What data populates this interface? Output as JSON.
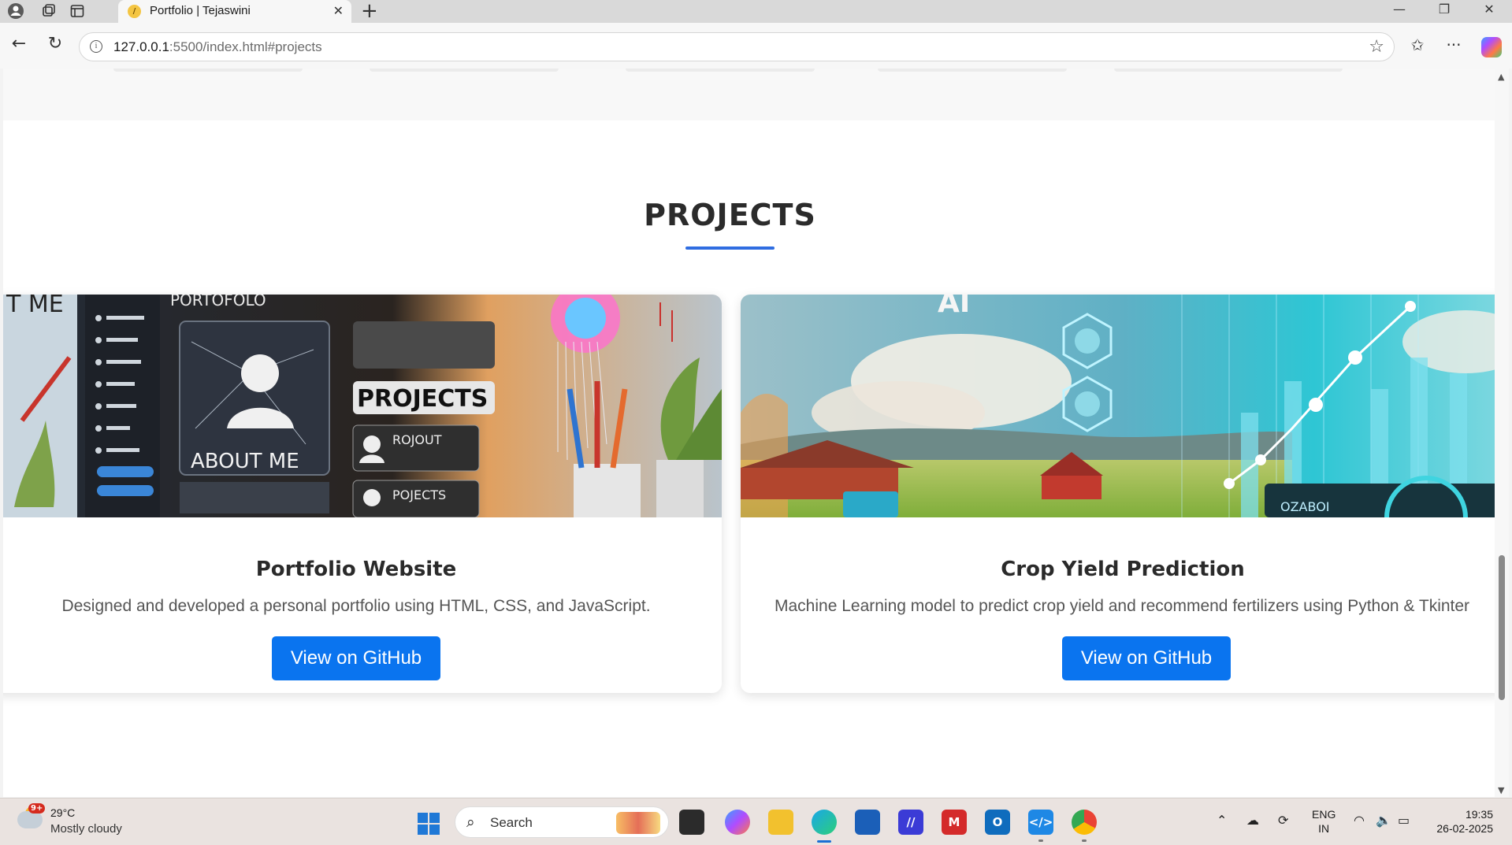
{
  "browser": {
    "tab_title": "Portfolio | Tejaswini",
    "tab_close": "✕",
    "new_tab": "+",
    "url_host": "127.0.0.1",
    "url_rest": ":5500/index.html#projects"
  },
  "page": {
    "section_title": "PROJECTS",
    "projects": [
      {
        "title": "Portfolio Website",
        "description": "Designed and developed a personal portfolio using HTML, CSS, and JavaScript.",
        "button": "View on GitHub",
        "image_labels": [
          "T ME",
          "PORTOFOLO",
          "PROJECTS",
          "ABOUT ME",
          "ROJOUT",
          "POJECTS"
        ]
      },
      {
        "title": "Crop Yield Prediction",
        "description": "Machine Learning model to predict crop yield and recommend fertilizers using Python & Tkinter",
        "button": "View on GitHub",
        "image_labels": [
          "AI",
          "OZABOI"
        ]
      }
    ]
  },
  "taskbar": {
    "weather_badge": "9+",
    "temperature": "29°C",
    "condition": "Mostly cloudy",
    "search_placeholder": "Search",
    "lang_line1": "ENG",
    "lang_line2": "IN",
    "time": "19:35",
    "date": "26-02-2025"
  },
  "colors": {
    "accent_blue": "#2f6de1",
    "button_blue": "#0a74ef"
  }
}
